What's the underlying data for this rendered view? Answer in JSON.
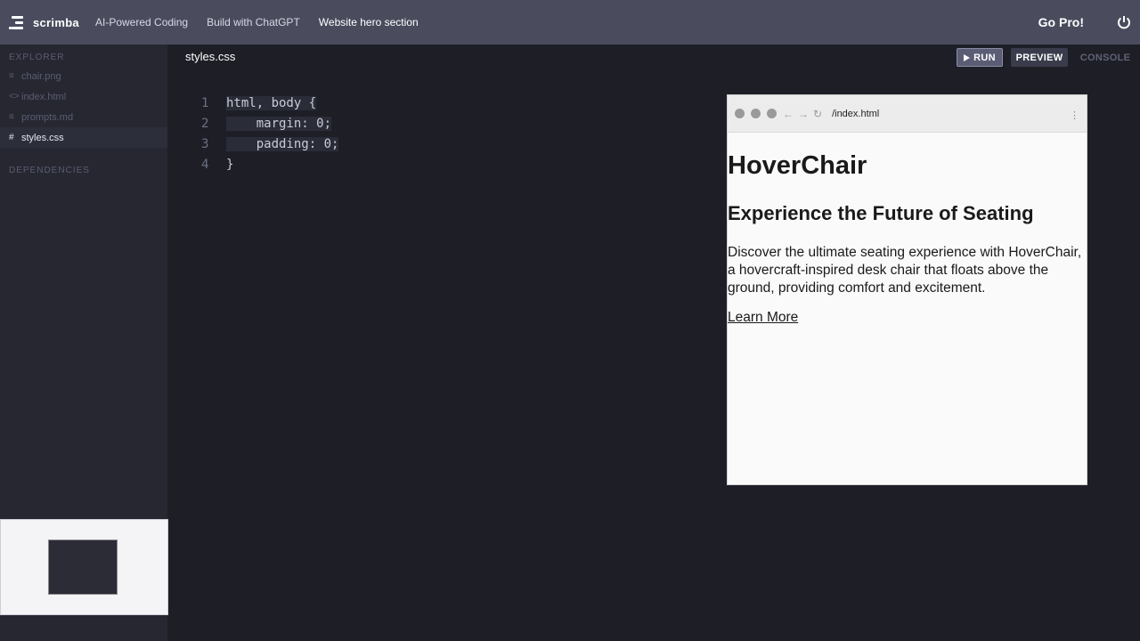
{
  "app": {
    "name": "scrimba"
  },
  "breadcrumbs": [
    "AI-Powered Coding",
    "Build with ChatGPT",
    "Website hero section"
  ],
  "header": {
    "gopro_label": "Go Pro!"
  },
  "sidebar": {
    "explorer_label": "EXPLORER",
    "files": [
      {
        "name": "chair.png",
        "icon": "≡"
      },
      {
        "name": "index.html",
        "icon": "<>"
      },
      {
        "name": "prompts.md",
        "icon": "≡"
      },
      {
        "name": "styles.css",
        "icon": "#"
      }
    ],
    "dependencies_label": "DEPENDENCIES"
  },
  "editor": {
    "tab": "styles.css",
    "lines": [
      {
        "num": "1",
        "text": "html, body {"
      },
      {
        "num": "2",
        "text": "    margin: 0;"
      },
      {
        "num": "3",
        "text": "    padding: 0;"
      },
      {
        "num": "4",
        "text": "}"
      }
    ]
  },
  "toolbar": {
    "run_label": "RUN",
    "preview_label": "PREVIEW",
    "console_label": "CONSOLE"
  },
  "preview": {
    "url": "/index.html",
    "h1": "HoverChair",
    "h2": "Experience the Future of Seating",
    "paragraph": "Discover the ultimate seating experience with HoverChair, a hovercraft-inspired desk chair that floats above the ground, providing comfort and excitement.",
    "link": "Learn More"
  },
  "colors": {
    "topbar": "#4a4c5e",
    "sidebar": "#262731",
    "editor": "#1e1f26",
    "accent": "#ffffff"
  }
}
